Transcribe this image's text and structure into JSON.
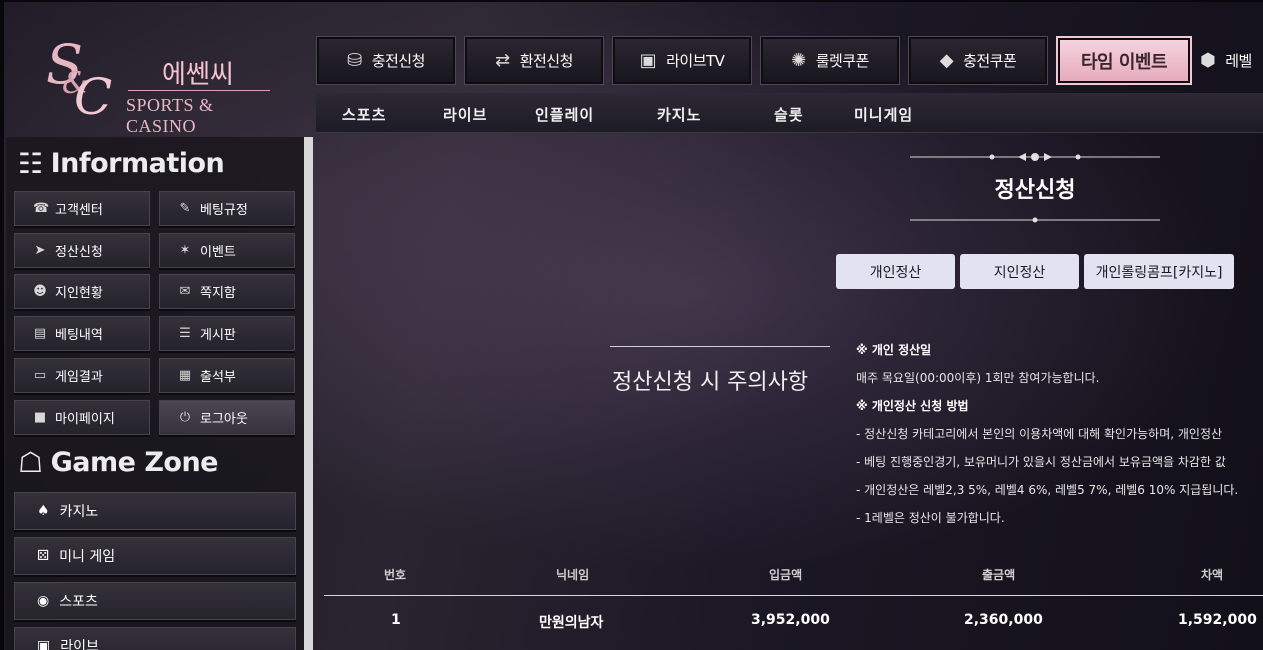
{
  "logo": {
    "mark": "S",
    "mark2": "C",
    "amp": "&",
    "korean": "에쎈씨",
    "english": "SPORTS & CASINO"
  },
  "topnav": [
    {
      "label": "충전신청",
      "icon": "coins-icon",
      "glyph": "⛁"
    },
    {
      "label": "환전신청",
      "icon": "exchange-icon",
      "glyph": "⇄"
    },
    {
      "label": "라이브TV",
      "icon": "live-tv-icon",
      "glyph": "▣"
    },
    {
      "label": "룰렛쿠폰",
      "icon": "roulette-icon",
      "glyph": "✺"
    },
    {
      "label": "충전쿠폰",
      "icon": "ticket-icon",
      "glyph": "◆"
    },
    {
      "label": "타임 이벤트",
      "icon": "",
      "glyph": ""
    },
    {
      "label": "레벨",
      "icon": "level-cube-icon",
      "glyph": "⬢"
    }
  ],
  "subnav": [
    "스포츠",
    "라이브",
    "인플레이",
    "카지노",
    "슬롯",
    "미니게임"
  ],
  "sidebar": {
    "info_title": "Information",
    "info_icon": "info-board-icon",
    "info_buttons": [
      {
        "label": "고객센터",
        "icon": "headset-icon",
        "glyph": "☎"
      },
      {
        "label": "베팅규정",
        "icon": "rule-icon",
        "glyph": "✎"
      },
      {
        "label": "정산신청",
        "icon": "settle-icon",
        "glyph": "➤"
      },
      {
        "label": "이벤트",
        "icon": "party-icon",
        "glyph": "✶"
      },
      {
        "label": "지인현황",
        "icon": "users-icon",
        "glyph": "☻"
      },
      {
        "label": "쪽지함",
        "icon": "message-icon",
        "glyph": "✉"
      },
      {
        "label": "베팅내역",
        "icon": "history-icon",
        "glyph": "▤"
      },
      {
        "label": "게시판",
        "icon": "board-icon",
        "glyph": "☰"
      },
      {
        "label": "게임결과",
        "icon": "monitor-icon",
        "glyph": "▭"
      },
      {
        "label": "출석부",
        "icon": "calendar-icon",
        "glyph": "▦"
      },
      {
        "label": "마이페이지",
        "icon": "user-icon",
        "glyph": "■"
      },
      {
        "label": "로그아웃",
        "icon": "power-icon",
        "glyph": "⏻"
      }
    ],
    "game_title": "Game Zone",
    "game_icon": "gamepad-icon",
    "game_buttons": [
      {
        "label": "카지노",
        "icon": "spade-icon",
        "glyph": "♠"
      },
      {
        "label": "미니 게임",
        "icon": "dice-icon",
        "glyph": "⚄"
      },
      {
        "label": "스포츠",
        "icon": "ball-icon",
        "glyph": "◉"
      },
      {
        "label": "라이브",
        "icon": "live-icon",
        "glyph": "▣"
      }
    ]
  },
  "page": {
    "title": "정산신청",
    "tabs": [
      "개인정산",
      "지인정산",
      "개인롤링콤프[카지노]"
    ],
    "notice_title": "정산신청 시 주의사항",
    "notice_lines": [
      {
        "text": "※ 개인 정산일",
        "head": true
      },
      {
        "text": "매주 목요일(00:00이후) 1회만 참여가능합니다.",
        "head": false
      },
      {
        "text": "※ 개인정산 신청 방법",
        "head": true
      },
      {
        "text": "- 정산신청 카테고리에서 본인의 이용차액에 대해 확인가능하며, 개인정산",
        "head": false
      },
      {
        "text": "- 베팅 진행중인경기, 보유머니가 있을시 정산금에서 보유금액을 차감한 값",
        "head": false
      },
      {
        "text": "- 개인정산은 레벨2,3 5%, 레벨4 6%, 레벨5 7%, 레벨6 10% 지급됩니다.",
        "head": false
      },
      {
        "text": "- 1레벨은 정산이 불가합니다.",
        "head": false
      }
    ]
  },
  "table": {
    "headers": [
      "번호",
      "닉네임",
      "입금액",
      "출금액",
      "차액"
    ],
    "rows": [
      [
        "1",
        "만원의남자",
        "3,952,000",
        "2,360,000",
        "1,592,000"
      ]
    ]
  }
}
